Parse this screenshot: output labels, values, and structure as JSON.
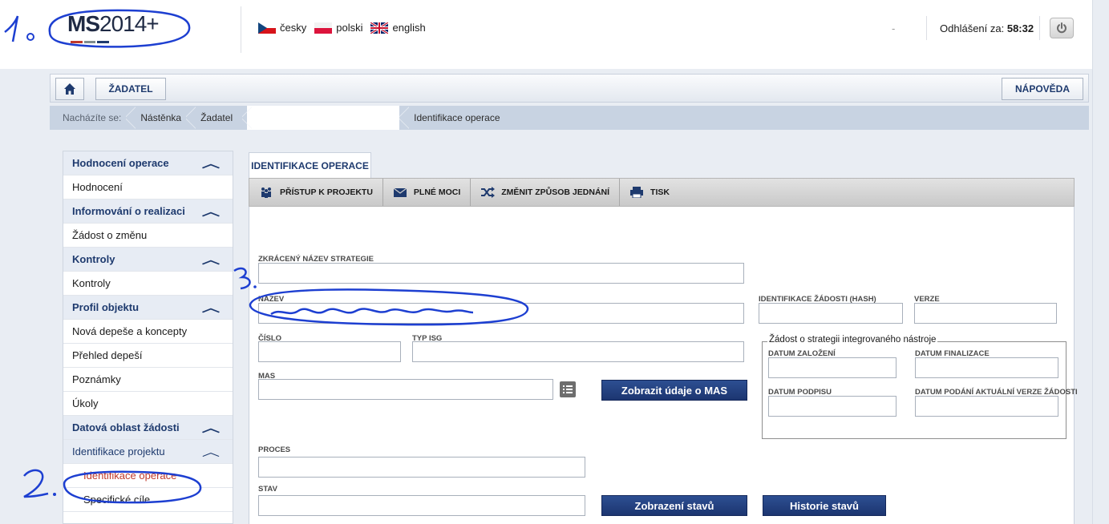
{
  "header": {
    "logo_bold": "MS",
    "logo_rest": "2014+",
    "languages": [
      {
        "label": "česky",
        "icon": "czech-flag-icon"
      },
      {
        "label": "polski",
        "icon": "polish-flag-icon"
      },
      {
        "label": "english",
        "icon": "uk-flag-icon"
      }
    ],
    "dash": "-",
    "logout_label": "Odhlášení za:",
    "logout_time": "58:32",
    "power_icon": "power-icon"
  },
  "nav": {
    "home_icon": "home-icon",
    "zadatel_label": "ŽADATEL",
    "napoveda_label": "NÁPOVĚDA"
  },
  "breadcrumb": {
    "prefix": "Nacházíte se:",
    "items": [
      "Nástěnka",
      "Žadatel",
      "",
      "Identifikace operace"
    ]
  },
  "sidebar": {
    "items": [
      {
        "label": "Hodnocení operace",
        "kind": "head",
        "chevron": "︿"
      },
      {
        "label": "Hodnocení",
        "kind": "item"
      },
      {
        "label": "Informování o realizaci",
        "kind": "head",
        "chevron": "︿"
      },
      {
        "label": "Žádost o změnu",
        "kind": "item"
      },
      {
        "label": "Kontroly",
        "kind": "head",
        "chevron": "︿"
      },
      {
        "label": "Kontroly",
        "kind": "item"
      },
      {
        "label": "Profil objektu",
        "kind": "head",
        "chevron": "︿"
      },
      {
        "label": "Nová depeše a koncepty",
        "kind": "item"
      },
      {
        "label": "Přehled depeší",
        "kind": "item"
      },
      {
        "label": "Poznámky",
        "kind": "item"
      },
      {
        "label": "Úkoly",
        "kind": "item"
      },
      {
        "label": "Datová oblast žádosti",
        "kind": "head",
        "chevron": "︿"
      },
      {
        "label": "Identifikace projektu",
        "kind": "head-plain",
        "chevron": "︿"
      },
      {
        "label": "Identifikace operace",
        "kind": "sub-active"
      },
      {
        "label": "Specifické cíle",
        "kind": "sub"
      }
    ]
  },
  "main": {
    "tab_label": "IDENTIFIKACE OPERACE",
    "toolbar": [
      {
        "label": "PŘÍSTUP K PROJEKTU",
        "icon": "people-icon"
      },
      {
        "label": "PLNÉ MOCI",
        "icon": "envelope-icon"
      },
      {
        "label": "ZMĚNIT ZPŮSOB JEDNÁNÍ",
        "icon": "shuffle-icon"
      },
      {
        "label": "TISK",
        "icon": "printer-icon"
      }
    ],
    "fields": {
      "zkraceny_label": "ZKRÁCENÝ NÁZEV STRATEGIE",
      "zkraceny_value": "",
      "nazev_label": "NÁZEV",
      "nazev_value": "",
      "cislo_label": "ČÍSLO",
      "cislo_value": "",
      "typ_label": "TYP ISG",
      "typ_value": "",
      "mas_label": "MAS",
      "mas_value": "",
      "proces_label": "PROCES",
      "proces_value": "",
      "stav_label": "STAV",
      "stav_value": "",
      "hash_label": "IDENTIFIKACE ŽÁDOSTI (HASH)",
      "hash_value": "",
      "verze_label": "VERZE",
      "verze_value": ""
    },
    "fieldset": {
      "legend": "Žádost o strategii integrovaného nástroje",
      "datum_zalozeni_label": "DATUM ZALOŽENÍ",
      "datum_finalizace_label": "DATUM FINALIZACE",
      "datum_podpisu_label": "DATUM PODPISU",
      "datum_podani_label": "DATUM PODÁNÍ AKTUÁLNÍ VERZE ŽÁDOSTI"
    },
    "buttons": {
      "zobrazit_mas": "Zobrazit údaje o MAS",
      "zobrazeni_stavu": "Zobrazení stavů",
      "historie_stavu": "Historie stavů"
    }
  },
  "annotations": [
    "1.",
    "2.",
    "3."
  ],
  "colors": {
    "accent": "#1e3a6e",
    "button_blue": "#22407e",
    "active_red": "#c0392b",
    "annotation_blue": "#1d3fd1"
  }
}
